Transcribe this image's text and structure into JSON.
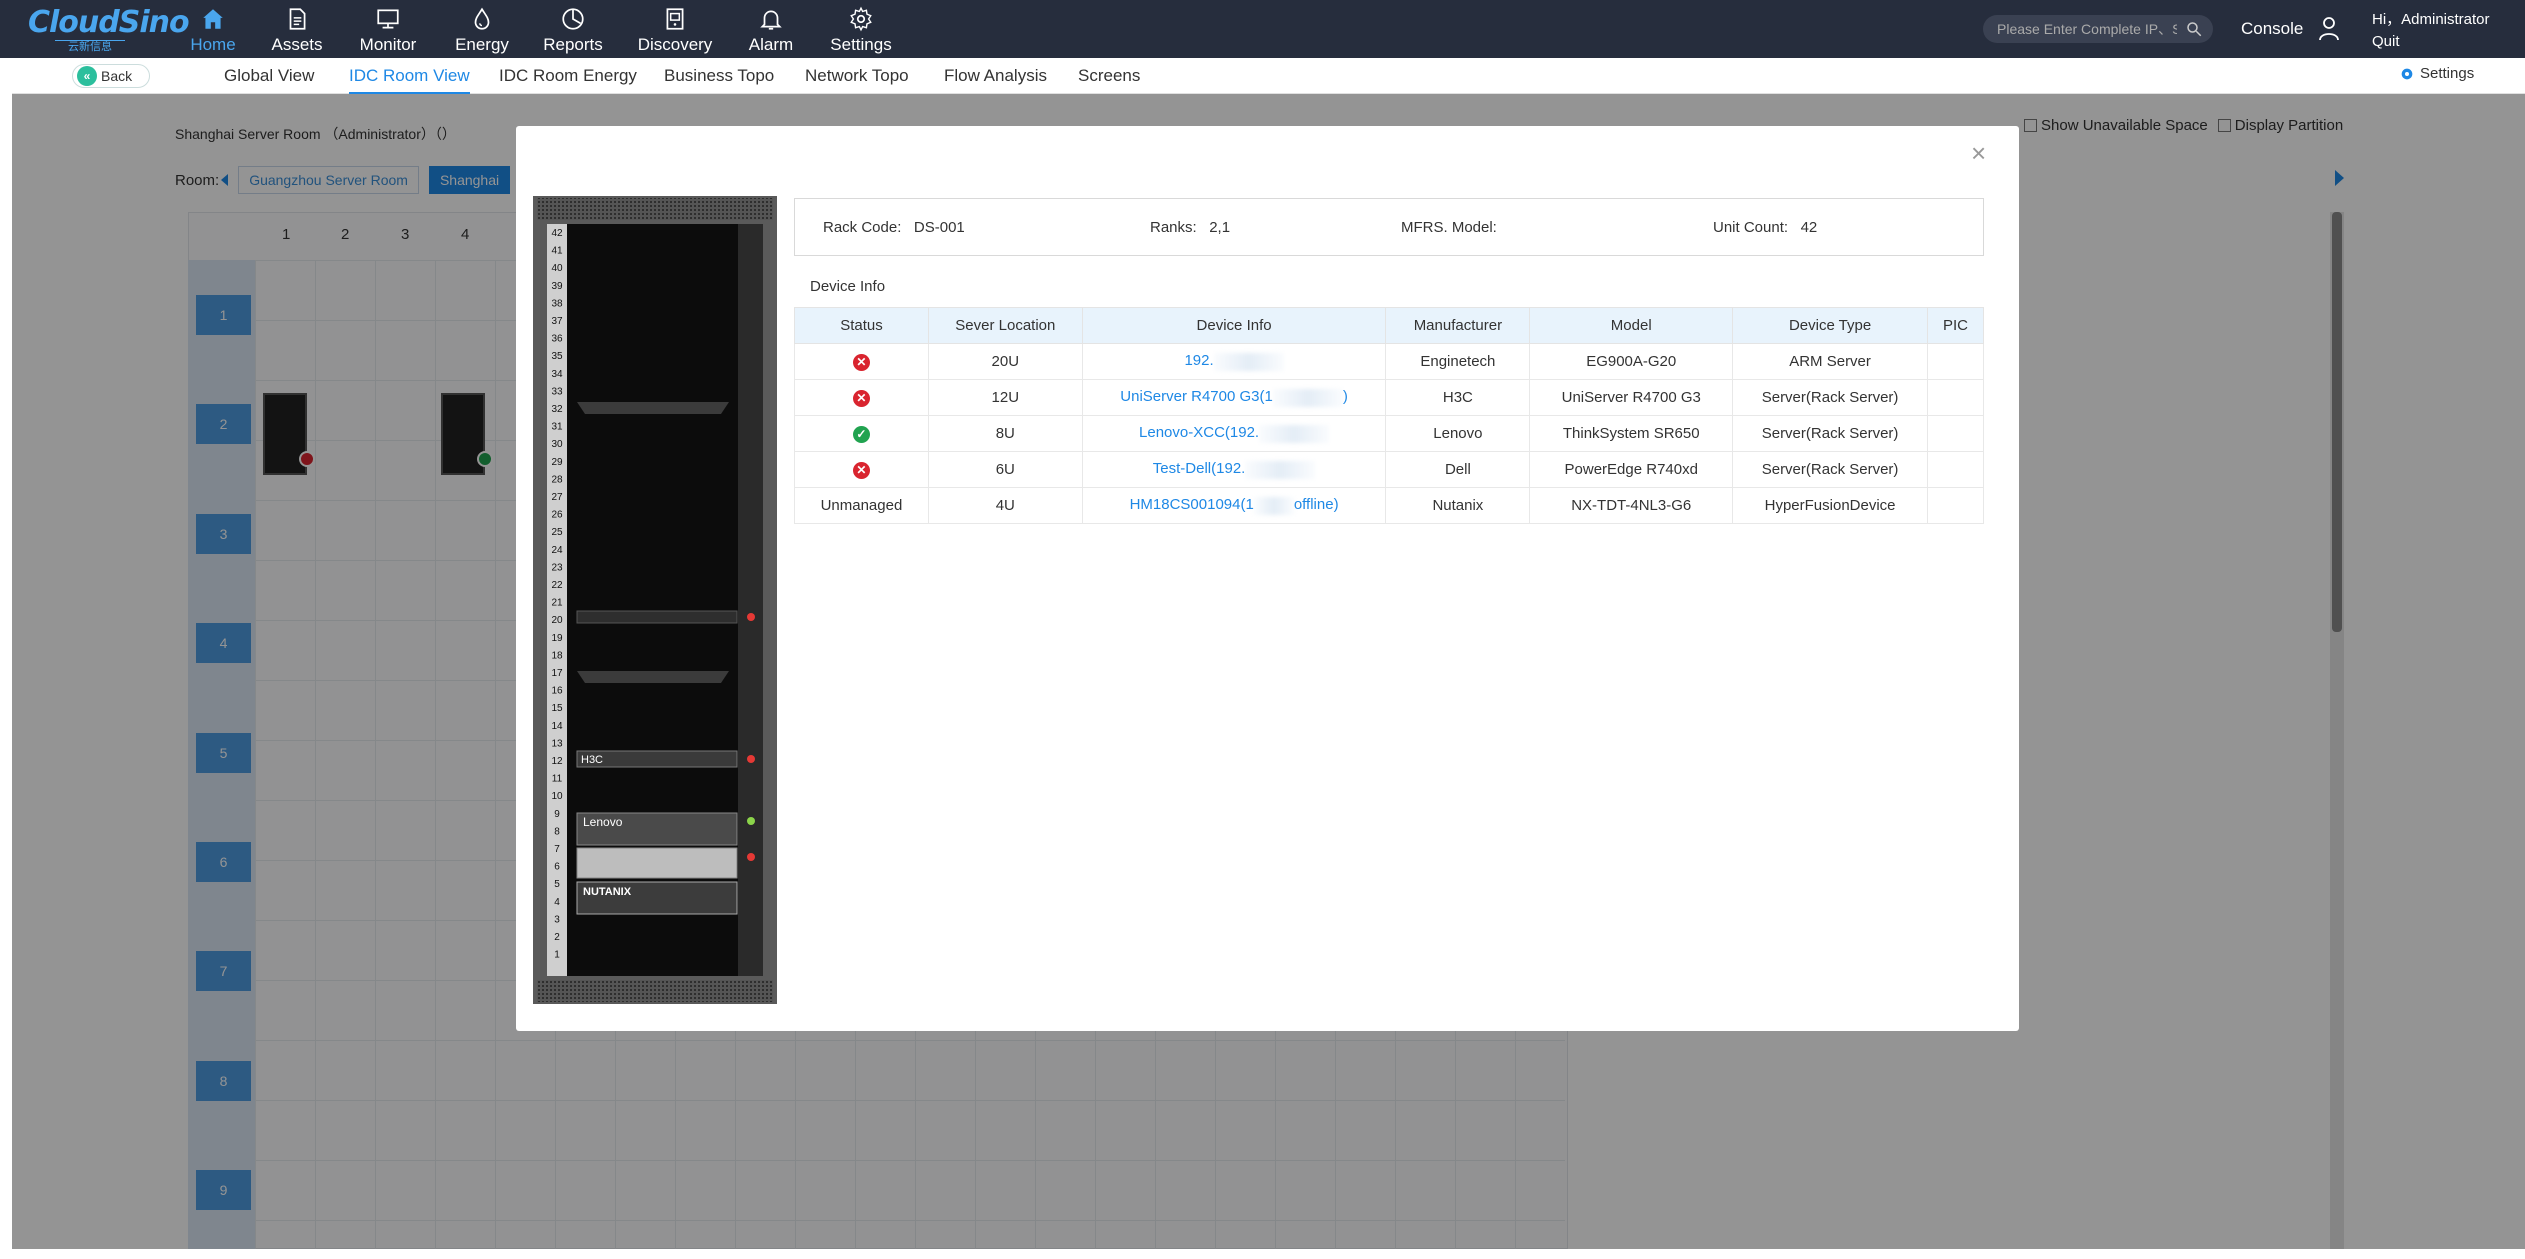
{
  "topbar": {
    "logo_text": "CloudSino",
    "logo_sub": "云新信息",
    "nav": [
      {
        "label": "Home",
        "icon": "home-icon",
        "active": true
      },
      {
        "label": "Assets",
        "icon": "document-icon",
        "active": false
      },
      {
        "label": "Monitor",
        "icon": "monitor-icon",
        "active": false
      },
      {
        "label": "Energy",
        "icon": "drop-icon",
        "active": false
      },
      {
        "label": "Reports",
        "icon": "pie-chart-icon",
        "active": false
      },
      {
        "label": "Discovery",
        "icon": "discovery-icon",
        "active": false
      },
      {
        "label": "Alarm",
        "icon": "bell-icon",
        "active": false
      },
      {
        "label": "Settings",
        "icon": "gear-icon",
        "active": false
      }
    ],
    "search_placeholder": "Please Enter Complete IP、SN",
    "console_label": "Console",
    "greeting": "Hi，Administrator",
    "quit_label": "Quit",
    "accent_color": "#4aa6ee",
    "bar_color": "#262d3d"
  },
  "subnav": {
    "back_label": "Back",
    "tabs": [
      {
        "label": "Global View",
        "active": false
      },
      {
        "label": "IDC Room View",
        "active": true
      },
      {
        "label": "IDC Room Energy",
        "active": false
      },
      {
        "label": "Business Topo",
        "active": false
      },
      {
        "label": "Network Topo",
        "active": false
      },
      {
        "label": "Flow Analysis",
        "active": false
      },
      {
        "label": "Screens",
        "active": false
      }
    ],
    "settings_label": "Settings"
  },
  "room": {
    "title": "Shanghai Server Room （Administrator）（）",
    "room_label": "Room:",
    "rooms": [
      "Guangzhou Server Room",
      "Shanghai"
    ],
    "active_room": "Shanghai",
    "show_unavailable_label": "Show Unavailable Space",
    "display_partition_label": "Display Partition",
    "columns": [
      "1",
      "2",
      "3",
      "4"
    ],
    "rows": [
      "1",
      "2",
      "3",
      "4",
      "5",
      "6",
      "7",
      "8",
      "9"
    ]
  },
  "modal": {
    "close_label": "×",
    "rack_code_label": "Rack Code:",
    "rack_code": "DS-001",
    "ranks_label": "Ranks:",
    "ranks": "2,1",
    "mfrs_label": "MFRS. Model:",
    "mfrs_model": "",
    "unit_count_label": "Unit Count:",
    "unit_count": "42",
    "device_info_title": "Device Info",
    "columns": [
      "Status",
      "Sever Location",
      "Device Info",
      "Manufacturer",
      "Model",
      "Device Type",
      "PIC"
    ],
    "rows": [
      {
        "status": "error",
        "status_text": "",
        "location": "20U",
        "device_info": "192.",
        "manufacturer": "Enginetech",
        "model": "EG900A-G20",
        "device_type": "ARM Server",
        "pic": ""
      },
      {
        "status": "error",
        "status_text": "",
        "location": "12U",
        "device_info": "UniServer R4700 G3(1",
        "device_info_tail": ")",
        "manufacturer": "H3C",
        "model": "UniServer R4700 G3",
        "device_type": "Server(Rack Server)",
        "pic": ""
      },
      {
        "status": "ok",
        "status_text": "",
        "location": "8U",
        "device_info": "Lenovo-XCC(192.",
        "manufacturer": "Lenovo",
        "model": "ThinkSystem SR650",
        "device_type": "Server(Rack Server)",
        "pic": ""
      },
      {
        "status": "error",
        "status_text": "",
        "location": "6U",
        "device_info": "Test-Dell(192.",
        "manufacturer": "Dell",
        "model": "PowerEdge R740xd",
        "device_type": "Server(Rack Server)",
        "pic": ""
      },
      {
        "status": "none",
        "status_text": "Unmanaged",
        "location": "4U",
        "device_info": "HM18CS001094(1",
        "device_info_tail": "offline)",
        "manufacturer": "Nutanix",
        "model": "NX-TDT-4NL3-G6",
        "device_type": "HyperFusionDevice",
        "pic": ""
      }
    ],
    "rack_units": [
      "42",
      "41",
      "40",
      "39",
      "38",
      "37",
      "36",
      "35",
      "34",
      "33",
      "32",
      "31",
      "30",
      "29",
      "28",
      "27",
      "26",
      "25",
      "24",
      "23",
      "22",
      "21",
      "20",
      "19",
      "18",
      "17",
      "16",
      "15",
      "14",
      "13",
      "12",
      "11",
      "10",
      "9",
      "8",
      "7",
      "6",
      "5",
      "4",
      "3",
      "2",
      "1"
    ],
    "rack_device_labels": [
      "H3C",
      "Lenovo",
      "NUTANIX"
    ],
    "status_colors": {
      "error": "#d9242f",
      "ok": "#21a350",
      "link": "#1e88e5"
    }
  }
}
